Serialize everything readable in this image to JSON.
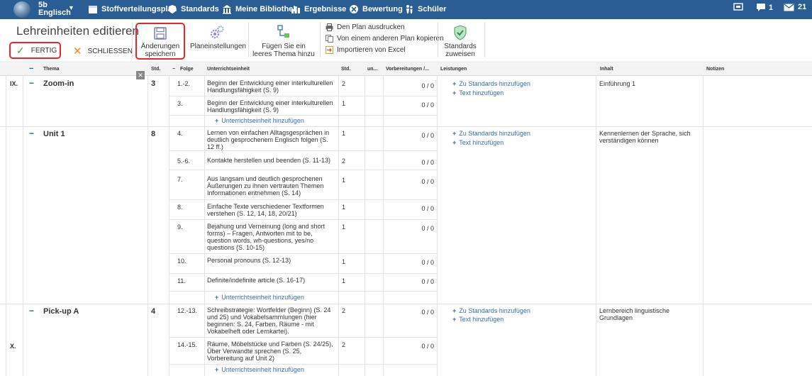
{
  "nav": {
    "class_line1": "5b",
    "class_line2": "Englisch",
    "items": [
      "Stoffverteilungsplan",
      "Standards",
      "Meine Bibliothek",
      "Ergebnisse",
      "Bewertung",
      "Schüler"
    ],
    "messages_count": "1",
    "mail_count": "21"
  },
  "toolbar": {
    "title": "Lehreinheiten editieren",
    "fertig": "FERTIG",
    "schliessen": "SCHLIESSEN",
    "save_line1": "Änderungen",
    "save_line2": "speichern",
    "plan_settings": "Planeinstellungen",
    "add_topic_line1": "Fügen Sie ein",
    "add_topic_line2": "leeres Thema hinzu",
    "print": "Den Plan ausdrucken",
    "copy": "Von einem anderen Plan kopieren",
    "import": "Importieren von Excel",
    "assign_line1": "Standards",
    "assign_line2": "zuweisen"
  },
  "headers": {
    "thema": "Thema",
    "std": "Std.",
    "folge": "Folge",
    "unterrichtseinheit": "Unterrichtseinheit",
    "std2": "Std.",
    "un": "un...",
    "vorbereitungen": "Vorbereitungen /...",
    "leistungen": "Leistungen",
    "inhalt": "Inhalt",
    "notizen": "Notizen"
  },
  "labels": {
    "add_standards": "Zu Standards hinzufügen",
    "add_text": "Text hinzufügen",
    "add_unit": "Unterrichtseinheit hinzufügen",
    "zero": "0 / 0"
  },
  "units": [
    {
      "roman": "IX.",
      "title": "Zoom-in",
      "hours": "3",
      "content": "Einführung 1",
      "lessons": [
        {
          "seq": "1.-2.",
          "text": "Beginn der Entwicklung einer interkulturellen Handlungsfähigkeit (S. 9)",
          "std": "2"
        },
        {
          "seq": "3.",
          "text": "Beginn der Entwicklung einer interkulturellen Handlungsfähigkeit (S. 9)",
          "std": "1"
        }
      ]
    },
    {
      "roman": "",
      "title": "Unit 1",
      "hours": "8",
      "content": "Kennenlernen der Sprache, sich verständigen können",
      "lessons": [
        {
          "seq": "4.",
          "text": "Lernen von einfachen Alltagsgesprächen in deutlich gesprochenem Englisch folgen (S. 12 ff.)",
          "std": "1"
        },
        {
          "seq": "5.-6.",
          "text": "Kontakte herstellen und beenden (S. 11-13)",
          "std": "2"
        },
        {
          "seq": "7.",
          "text": "Aus langsam und deutlich gesprochenen Äußerungen zu ihnen vertrauten Themen Informationen entnehmen (S. 14)",
          "std": "1"
        },
        {
          "seq": "8.",
          "text": "Einfache Texte verschiedener Textformen verstehen (S. 12, 14, 18, 20/21)",
          "std": "1"
        },
        {
          "seq": "9.",
          "text": "Bejahung und Verneinung (long and short forms) – Fragen, Antworten mit to be, question words, wh-questions, yes/no questions (S. 10-15)",
          "std": "1"
        },
        {
          "seq": "10.",
          "text": "Personal pronouns (S. 12-13)",
          "std": "1"
        },
        {
          "seq": "11.",
          "text": "Definite/indefinite article (S. 16-17)",
          "std": "1"
        }
      ]
    },
    {
      "roman": "X.",
      "title": "Pick-up A",
      "hours": "4",
      "content": "Lernbereich linguistische Grundlagen",
      "lessons": [
        {
          "seq": "12.-13.",
          "text": "Schreibstrategie: Wortfelder (Beginn) (S. 24 und 25) und Vokabelsammlungen (hier beginnen: S. 24, Farben, Räume - mit Vokabelheft oder Lernkartei).",
          "std": "2"
        },
        {
          "seq": "14.-15.",
          "text": "Räume, Möbelstücke und Farben (S. 24/25), Über Verwandte sprechen (S. 25, Vorbereitung auf Unit 2)",
          "std": "2"
        }
      ]
    }
  ],
  "colors": {
    "nav_bg": "#2a5d93",
    "accent_red": "#e8262b",
    "link": "#3a6da8",
    "check_green": "#3aa846",
    "close_orange": "#f28a1a"
  }
}
